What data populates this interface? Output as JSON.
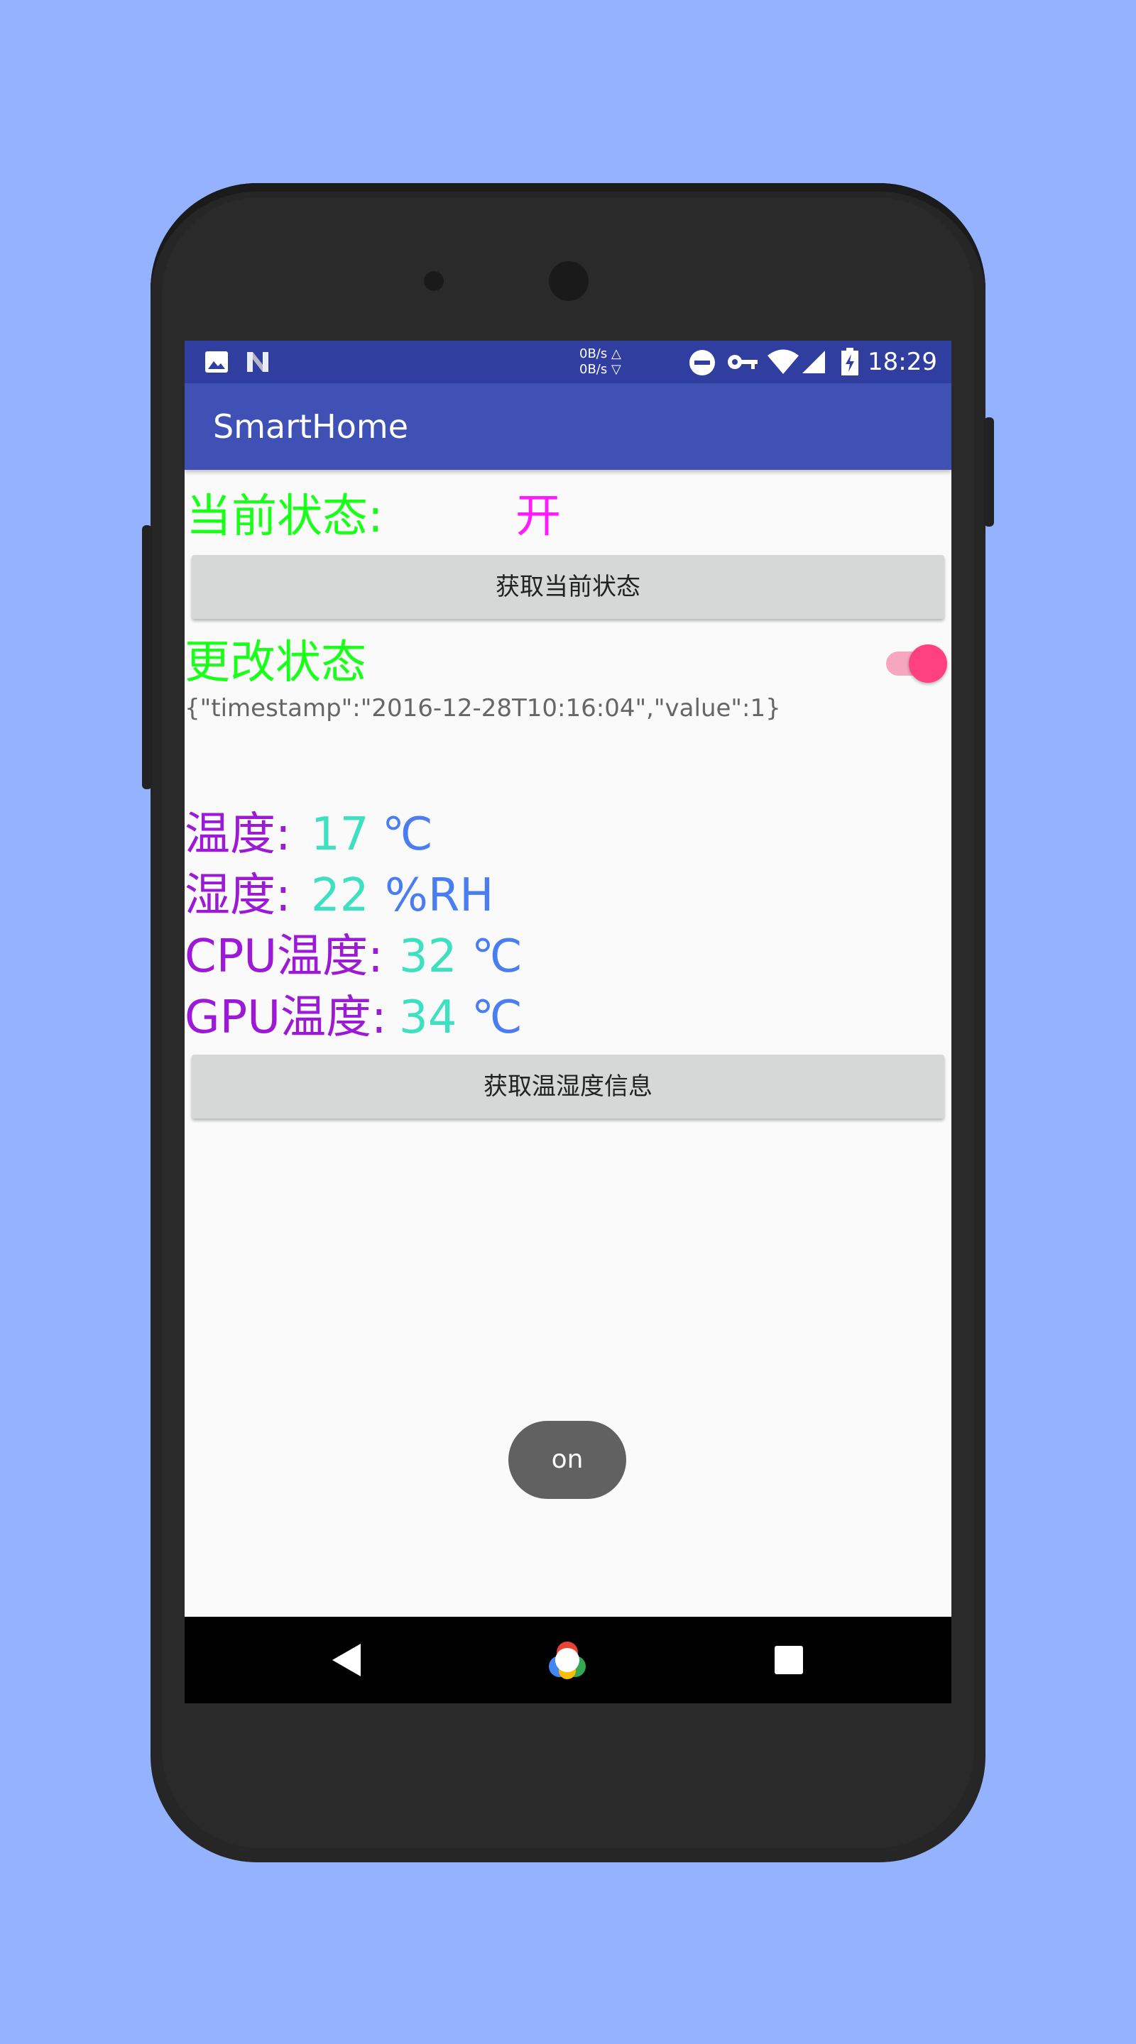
{
  "status_bar": {
    "net_up": "0B/s △",
    "net_down": "0B/s ▽",
    "time": "18:29",
    "icons": [
      "image-icon",
      "n-icon",
      "dnd-icon",
      "key-icon",
      "wifi-icon",
      "signal-icon",
      "battery-icon"
    ]
  },
  "app_bar": {
    "title": "SmartHome"
  },
  "current_state": {
    "label": "当前状态:",
    "value": "开",
    "get_button": "获取当前状态"
  },
  "change_state": {
    "label": "更改状态",
    "switch_on": true,
    "response_json": "{\"timestamp\":\"2016-12-28T10:16:04\",\"value\":1}"
  },
  "sensors": [
    {
      "label": "温度:",
      "value": "17",
      "unit": "℃"
    },
    {
      "label": "湿度:",
      "value": "22",
      "unit": "%RH"
    },
    {
      "label": "CPU温度:",
      "value": "32",
      "unit": "℃"
    },
    {
      "label": "GPU温度:",
      "value": "34",
      "unit": "℃"
    }
  ],
  "sensor_button": "获取温湿度信息",
  "toast": "on",
  "colors": {
    "background": "#94b2fd",
    "primary": "#3f51b5",
    "primary_dark": "#303f9f",
    "accent": "#ff4081",
    "label_green": "#1aff1a",
    "value_magenta": "#ff1aff",
    "sensor_label": "#9c1ad6",
    "sensor_value": "#3de0c0",
    "sensor_unit": "#4a7df0"
  }
}
